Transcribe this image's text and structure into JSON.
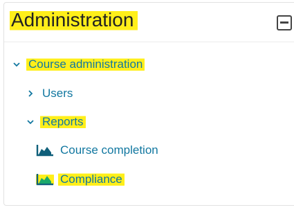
{
  "block": {
    "title": "Administration"
  },
  "tree": {
    "course_admin": "Course administration",
    "users": "Users",
    "reports": "Reports",
    "course_completion": "Course completion",
    "compliance": "Compliance"
  },
  "colors": {
    "link": "#1177a0",
    "highlight": "#ffef1a",
    "icon_dark": "#0f5f7a",
    "icon_fill": "#1aa86b"
  }
}
